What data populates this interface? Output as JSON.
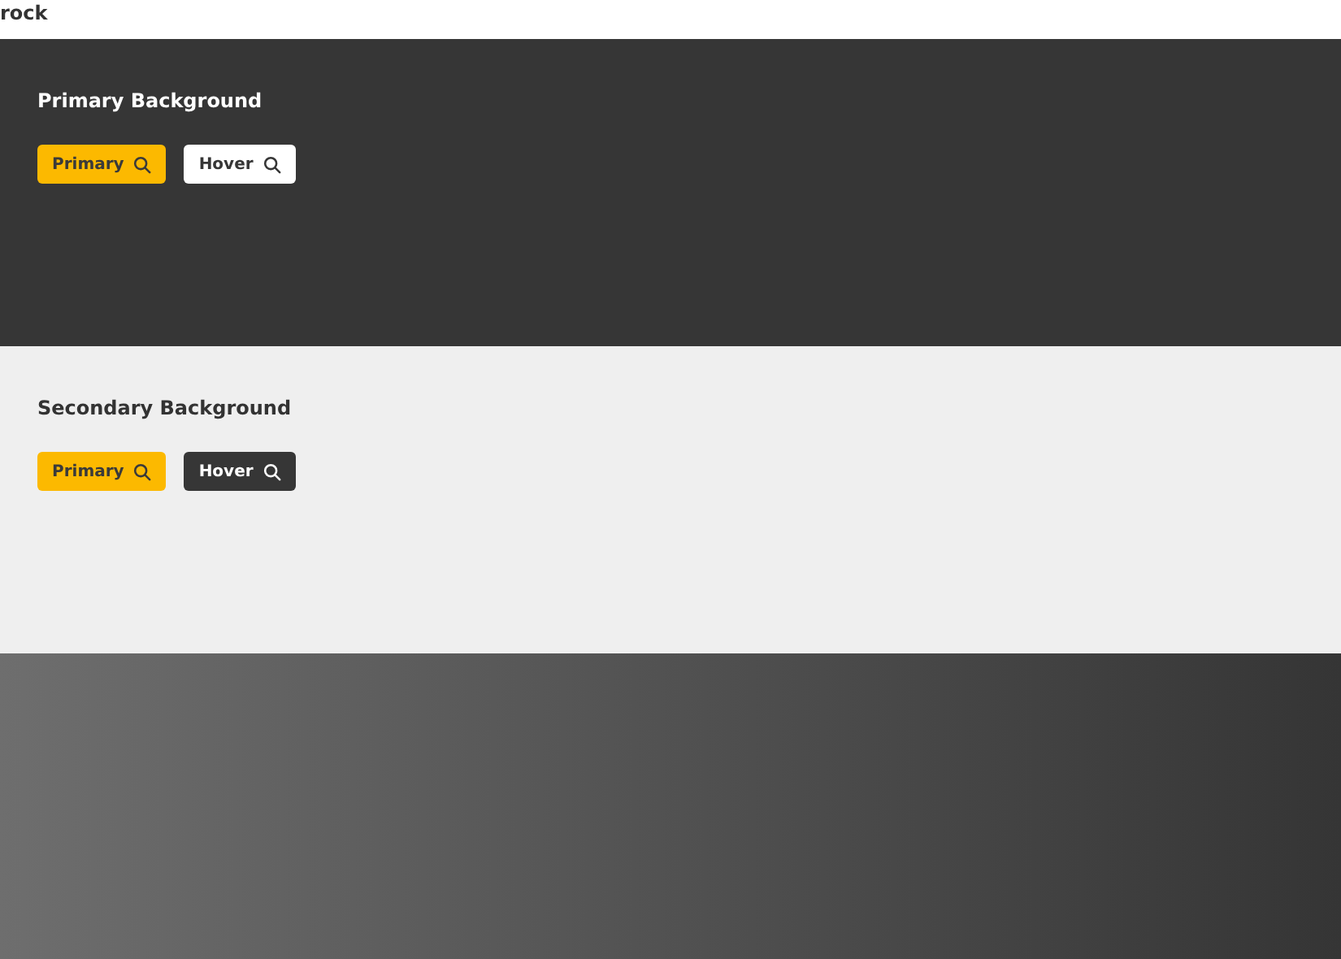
{
  "header": {
    "title": "rock"
  },
  "sections": [
    {
      "kind": "dark",
      "heading": "Primary Background",
      "buttons": [
        {
          "kind": "primary",
          "label": "Primary"
        },
        {
          "kind": "hover",
          "label": "Hover"
        }
      ]
    },
    {
      "kind": "light",
      "heading": "Secondary Background",
      "buttons": [
        {
          "kind": "primary",
          "label": "Primary"
        },
        {
          "kind": "hover",
          "label": "Hover"
        }
      ]
    },
    {
      "kind": "gradient"
    }
  ]
}
